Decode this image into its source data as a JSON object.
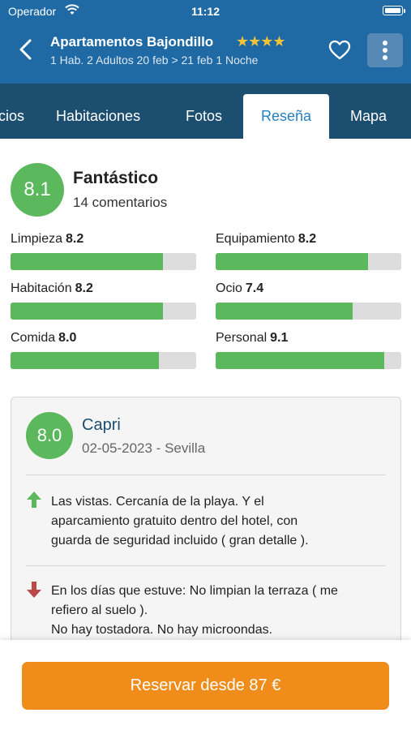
{
  "status_bar": {
    "carrier": "Operador",
    "time": "11:12"
  },
  "header": {
    "title": "Apartamentos Bajondillo",
    "stars": "★★★★",
    "subtitle": "1 Hab. 2 Adultos 20 feb > 21 feb 1 Noche"
  },
  "tabs": [
    {
      "label": "cios"
    },
    {
      "label": "Habitaciones"
    },
    {
      "label": "Fotos"
    },
    {
      "label": "Reseña"
    },
    {
      "label": "Mapa"
    }
  ],
  "active_tab": "Reseña",
  "summary": {
    "score": "8.1",
    "label": "Fantástico",
    "count": "14 comentarios"
  },
  "categories": [
    {
      "name": "Limpieza",
      "score": "8.2",
      "fraction": 0.82
    },
    {
      "name": "Equipamiento",
      "score": "8.2",
      "fraction": 0.82
    },
    {
      "name": "Habitación",
      "score": "8.2",
      "fraction": 0.82
    },
    {
      "name": "Ocio",
      "score": "7.4",
      "fraction": 0.74
    },
    {
      "name": "Comida",
      "score": "8.0",
      "fraction": 0.8
    },
    {
      "name": "Personal",
      "score": "9.1",
      "fraction": 0.91
    }
  ],
  "review": {
    "score": "8.0",
    "name": "Capri",
    "meta": "02-05-2023 - Sevilla",
    "positive": [
      "Las vistas. Cercanía de la playa. Y el",
      "aparcamiento gratuito dentro del hotel, con",
      "guarda de seguridad incluido ( gran detalle )."
    ],
    "negative": [
      "En los días que estuve: No limpian la terraza ( me",
      "refiero al suelo ).",
      "No hay tostadora. No hay microondas."
    ]
  },
  "cta": {
    "label": "Reservar desde 87 €"
  },
  "colors": {
    "header": "#1f6aa5",
    "tabs": "#1c4e70",
    "score": "#5cb85c",
    "cta": "#ef8c1a",
    "positive": "#5cb85c",
    "negative": "#b94a48"
  }
}
